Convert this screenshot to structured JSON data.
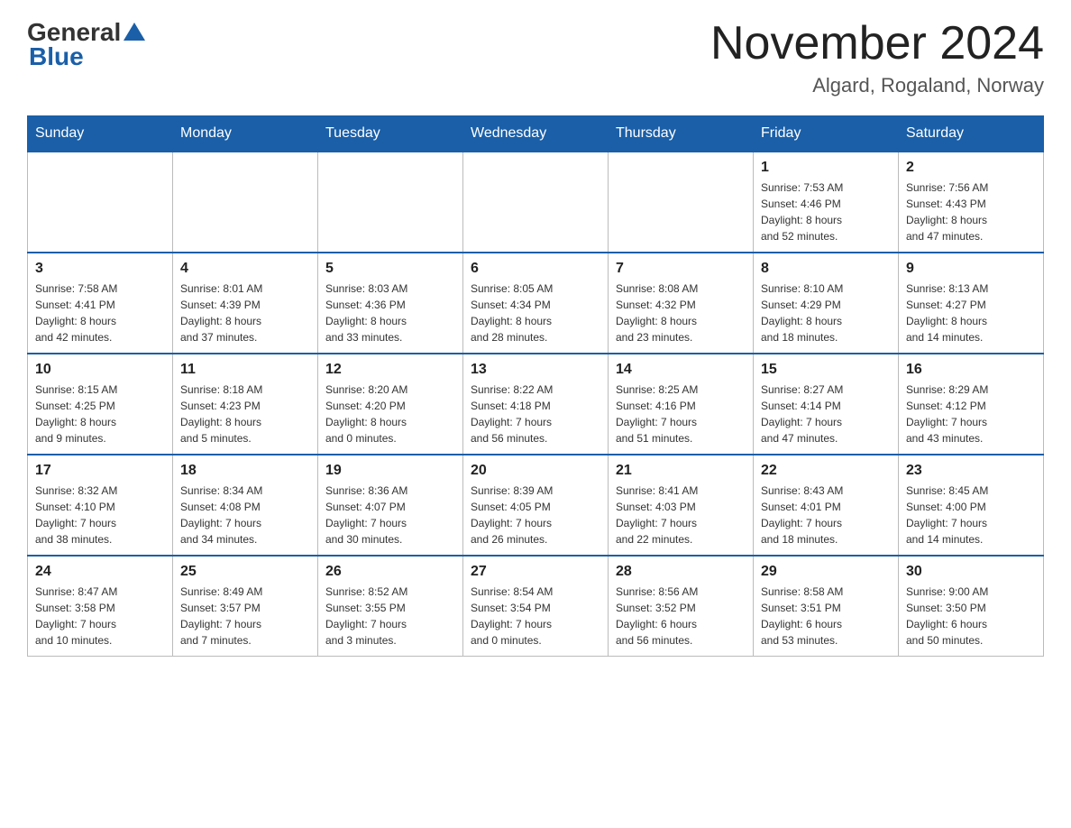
{
  "header": {
    "logo_general": "General",
    "logo_blue": "Blue",
    "month_title": "November 2024",
    "location": "Algard, Rogaland, Norway"
  },
  "days_of_week": [
    "Sunday",
    "Monday",
    "Tuesday",
    "Wednesday",
    "Thursday",
    "Friday",
    "Saturday"
  ],
  "weeks": [
    [
      {
        "day": "",
        "info": ""
      },
      {
        "day": "",
        "info": ""
      },
      {
        "day": "",
        "info": ""
      },
      {
        "day": "",
        "info": ""
      },
      {
        "day": "",
        "info": ""
      },
      {
        "day": "1",
        "info": "Sunrise: 7:53 AM\nSunset: 4:46 PM\nDaylight: 8 hours\nand 52 minutes."
      },
      {
        "day": "2",
        "info": "Sunrise: 7:56 AM\nSunset: 4:43 PM\nDaylight: 8 hours\nand 47 minutes."
      }
    ],
    [
      {
        "day": "3",
        "info": "Sunrise: 7:58 AM\nSunset: 4:41 PM\nDaylight: 8 hours\nand 42 minutes."
      },
      {
        "day": "4",
        "info": "Sunrise: 8:01 AM\nSunset: 4:39 PM\nDaylight: 8 hours\nand 37 minutes."
      },
      {
        "day": "5",
        "info": "Sunrise: 8:03 AM\nSunset: 4:36 PM\nDaylight: 8 hours\nand 33 minutes."
      },
      {
        "day": "6",
        "info": "Sunrise: 8:05 AM\nSunset: 4:34 PM\nDaylight: 8 hours\nand 28 minutes."
      },
      {
        "day": "7",
        "info": "Sunrise: 8:08 AM\nSunset: 4:32 PM\nDaylight: 8 hours\nand 23 minutes."
      },
      {
        "day": "8",
        "info": "Sunrise: 8:10 AM\nSunset: 4:29 PM\nDaylight: 8 hours\nand 18 minutes."
      },
      {
        "day": "9",
        "info": "Sunrise: 8:13 AM\nSunset: 4:27 PM\nDaylight: 8 hours\nand 14 minutes."
      }
    ],
    [
      {
        "day": "10",
        "info": "Sunrise: 8:15 AM\nSunset: 4:25 PM\nDaylight: 8 hours\nand 9 minutes."
      },
      {
        "day": "11",
        "info": "Sunrise: 8:18 AM\nSunset: 4:23 PM\nDaylight: 8 hours\nand 5 minutes."
      },
      {
        "day": "12",
        "info": "Sunrise: 8:20 AM\nSunset: 4:20 PM\nDaylight: 8 hours\nand 0 minutes."
      },
      {
        "day": "13",
        "info": "Sunrise: 8:22 AM\nSunset: 4:18 PM\nDaylight: 7 hours\nand 56 minutes."
      },
      {
        "day": "14",
        "info": "Sunrise: 8:25 AM\nSunset: 4:16 PM\nDaylight: 7 hours\nand 51 minutes."
      },
      {
        "day": "15",
        "info": "Sunrise: 8:27 AM\nSunset: 4:14 PM\nDaylight: 7 hours\nand 47 minutes."
      },
      {
        "day": "16",
        "info": "Sunrise: 8:29 AM\nSunset: 4:12 PM\nDaylight: 7 hours\nand 43 minutes."
      }
    ],
    [
      {
        "day": "17",
        "info": "Sunrise: 8:32 AM\nSunset: 4:10 PM\nDaylight: 7 hours\nand 38 minutes."
      },
      {
        "day": "18",
        "info": "Sunrise: 8:34 AM\nSunset: 4:08 PM\nDaylight: 7 hours\nand 34 minutes."
      },
      {
        "day": "19",
        "info": "Sunrise: 8:36 AM\nSunset: 4:07 PM\nDaylight: 7 hours\nand 30 minutes."
      },
      {
        "day": "20",
        "info": "Sunrise: 8:39 AM\nSunset: 4:05 PM\nDaylight: 7 hours\nand 26 minutes."
      },
      {
        "day": "21",
        "info": "Sunrise: 8:41 AM\nSunset: 4:03 PM\nDaylight: 7 hours\nand 22 minutes."
      },
      {
        "day": "22",
        "info": "Sunrise: 8:43 AM\nSunset: 4:01 PM\nDaylight: 7 hours\nand 18 minutes."
      },
      {
        "day": "23",
        "info": "Sunrise: 8:45 AM\nSunset: 4:00 PM\nDaylight: 7 hours\nand 14 minutes."
      }
    ],
    [
      {
        "day": "24",
        "info": "Sunrise: 8:47 AM\nSunset: 3:58 PM\nDaylight: 7 hours\nand 10 minutes."
      },
      {
        "day": "25",
        "info": "Sunrise: 8:49 AM\nSunset: 3:57 PM\nDaylight: 7 hours\nand 7 minutes."
      },
      {
        "day": "26",
        "info": "Sunrise: 8:52 AM\nSunset: 3:55 PM\nDaylight: 7 hours\nand 3 minutes."
      },
      {
        "day": "27",
        "info": "Sunrise: 8:54 AM\nSunset: 3:54 PM\nDaylight: 7 hours\nand 0 minutes."
      },
      {
        "day": "28",
        "info": "Sunrise: 8:56 AM\nSunset: 3:52 PM\nDaylight: 6 hours\nand 56 minutes."
      },
      {
        "day": "29",
        "info": "Sunrise: 8:58 AM\nSunset: 3:51 PM\nDaylight: 6 hours\nand 53 minutes."
      },
      {
        "day": "30",
        "info": "Sunrise: 9:00 AM\nSunset: 3:50 PM\nDaylight: 6 hours\nand 50 minutes."
      }
    ]
  ]
}
